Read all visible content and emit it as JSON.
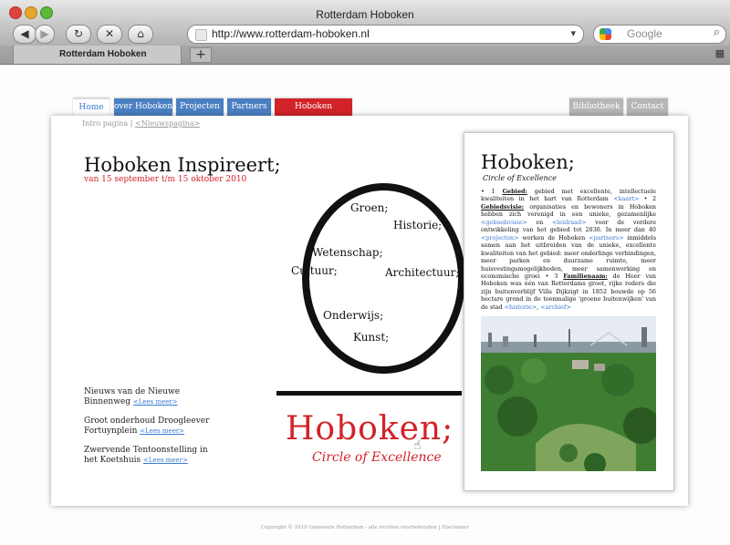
{
  "browser": {
    "window_title": "Rotterdam Hoboken",
    "url": "http://www.rotterdam-hoboken.nl",
    "search_placeholder": "Google",
    "tab_label": "Rotterdam Hoboken",
    "new_tab": "+"
  },
  "nav": {
    "tabs": [
      {
        "label": "Home",
        "color": "#ffffff",
        "text_color": "#3d7bd1"
      },
      {
        "label": "over Hoboken",
        "color": "#4a7fc1",
        "text_color": "#ffffff"
      },
      {
        "label": "Projecten",
        "color": "#4a7fc1",
        "text_color": "#ffffff"
      },
      {
        "label": "Partners",
        "color": "#4a7fc1",
        "text_color": "#ffffff"
      },
      {
        "label": "Hoboken Inspireert",
        "color": "#d2232a",
        "text_color": "#ffffff"
      }
    ],
    "right_tabs": [
      {
        "label": "Bibliotheek",
        "color": "#b6b6b6"
      },
      {
        "label": "Contact",
        "color": "#b6b6b6"
      }
    ]
  },
  "breadcrumb": {
    "part1": "Intro pagina",
    "separator": "|",
    "part2": "<Nieuwspagina>"
  },
  "main": {
    "title": "Hoboken Inspireert;",
    "date": "van 15 september t/m 15 oktober 2010",
    "circle_words": [
      "Groen;",
      "Historie;",
      "Wetenschap;",
      "Cultuur;",
      "Architectuur;",
      "Onderwijs;",
      "Kunst;"
    ],
    "logo": "Hoboken;",
    "logo_tagline": "Circle of Excellence"
  },
  "news": [
    {
      "title": "Nieuws van de Nieuwe Binnenweg",
      "more": "<Lees meer>"
    },
    {
      "title": "Groot onderhoud Droogleever Fortuynplein",
      "more": "<Lees meer>"
    },
    {
      "title": "Zwervende Tentoonstelling in het Koetshuis",
      "more": "<Lees meer>"
    }
  ],
  "sidebar": {
    "title": "Hoboken;",
    "subtitle": "Circle of Excellence",
    "t1": "• 1 ",
    "k1": "Gebied:",
    "t2": " gebied met excellente, intellectuele kwaliteiten in het hart van Rotterdam ",
    "l1": "<kaart>",
    "t3": " • 2 ",
    "k2": "Gebiedsvisie:",
    "t4": " organisaties en bewoners in Hoboken hebben zich verenigd in een unieke, gezamenlijke ",
    "l2": "<gebiedsvisie>",
    "t5": " en ",
    "l3": "<leidraad>",
    "t6": " voor de verdere ontwikkeling van het gebied tot 2030. In meer dan 40 ",
    "l4": "<projecten>",
    "t7": " werken de Hoboken ",
    "l5": "<partners>",
    "t8": " inmiddels samen aan het uitbreiden van de unieke, excellente kwaliteiten van het gebied: meer onderlinge verbindingen, meer parken en duurzame ruimte, meer huisvestingsmogelijkheden, meer samenwerking en economische groei • 3 ",
    "k3": "Familienaam:",
    "t9": " de Heer van Hoboken was één van Rotterdams groot, rijke reders die zijn buitenverblijf Villa Dijkzigt in 1852 bouwde op 56 hectare grond in de toenmalige 'groene buitenwijken' van de stad ",
    "l6": "<historie>",
    "t10": ", ",
    "l7": "<archief>"
  },
  "footer": "Copyright © 2010 Gemeente Rotterdam - alle rechten voorbehouden | Disclaimer"
}
